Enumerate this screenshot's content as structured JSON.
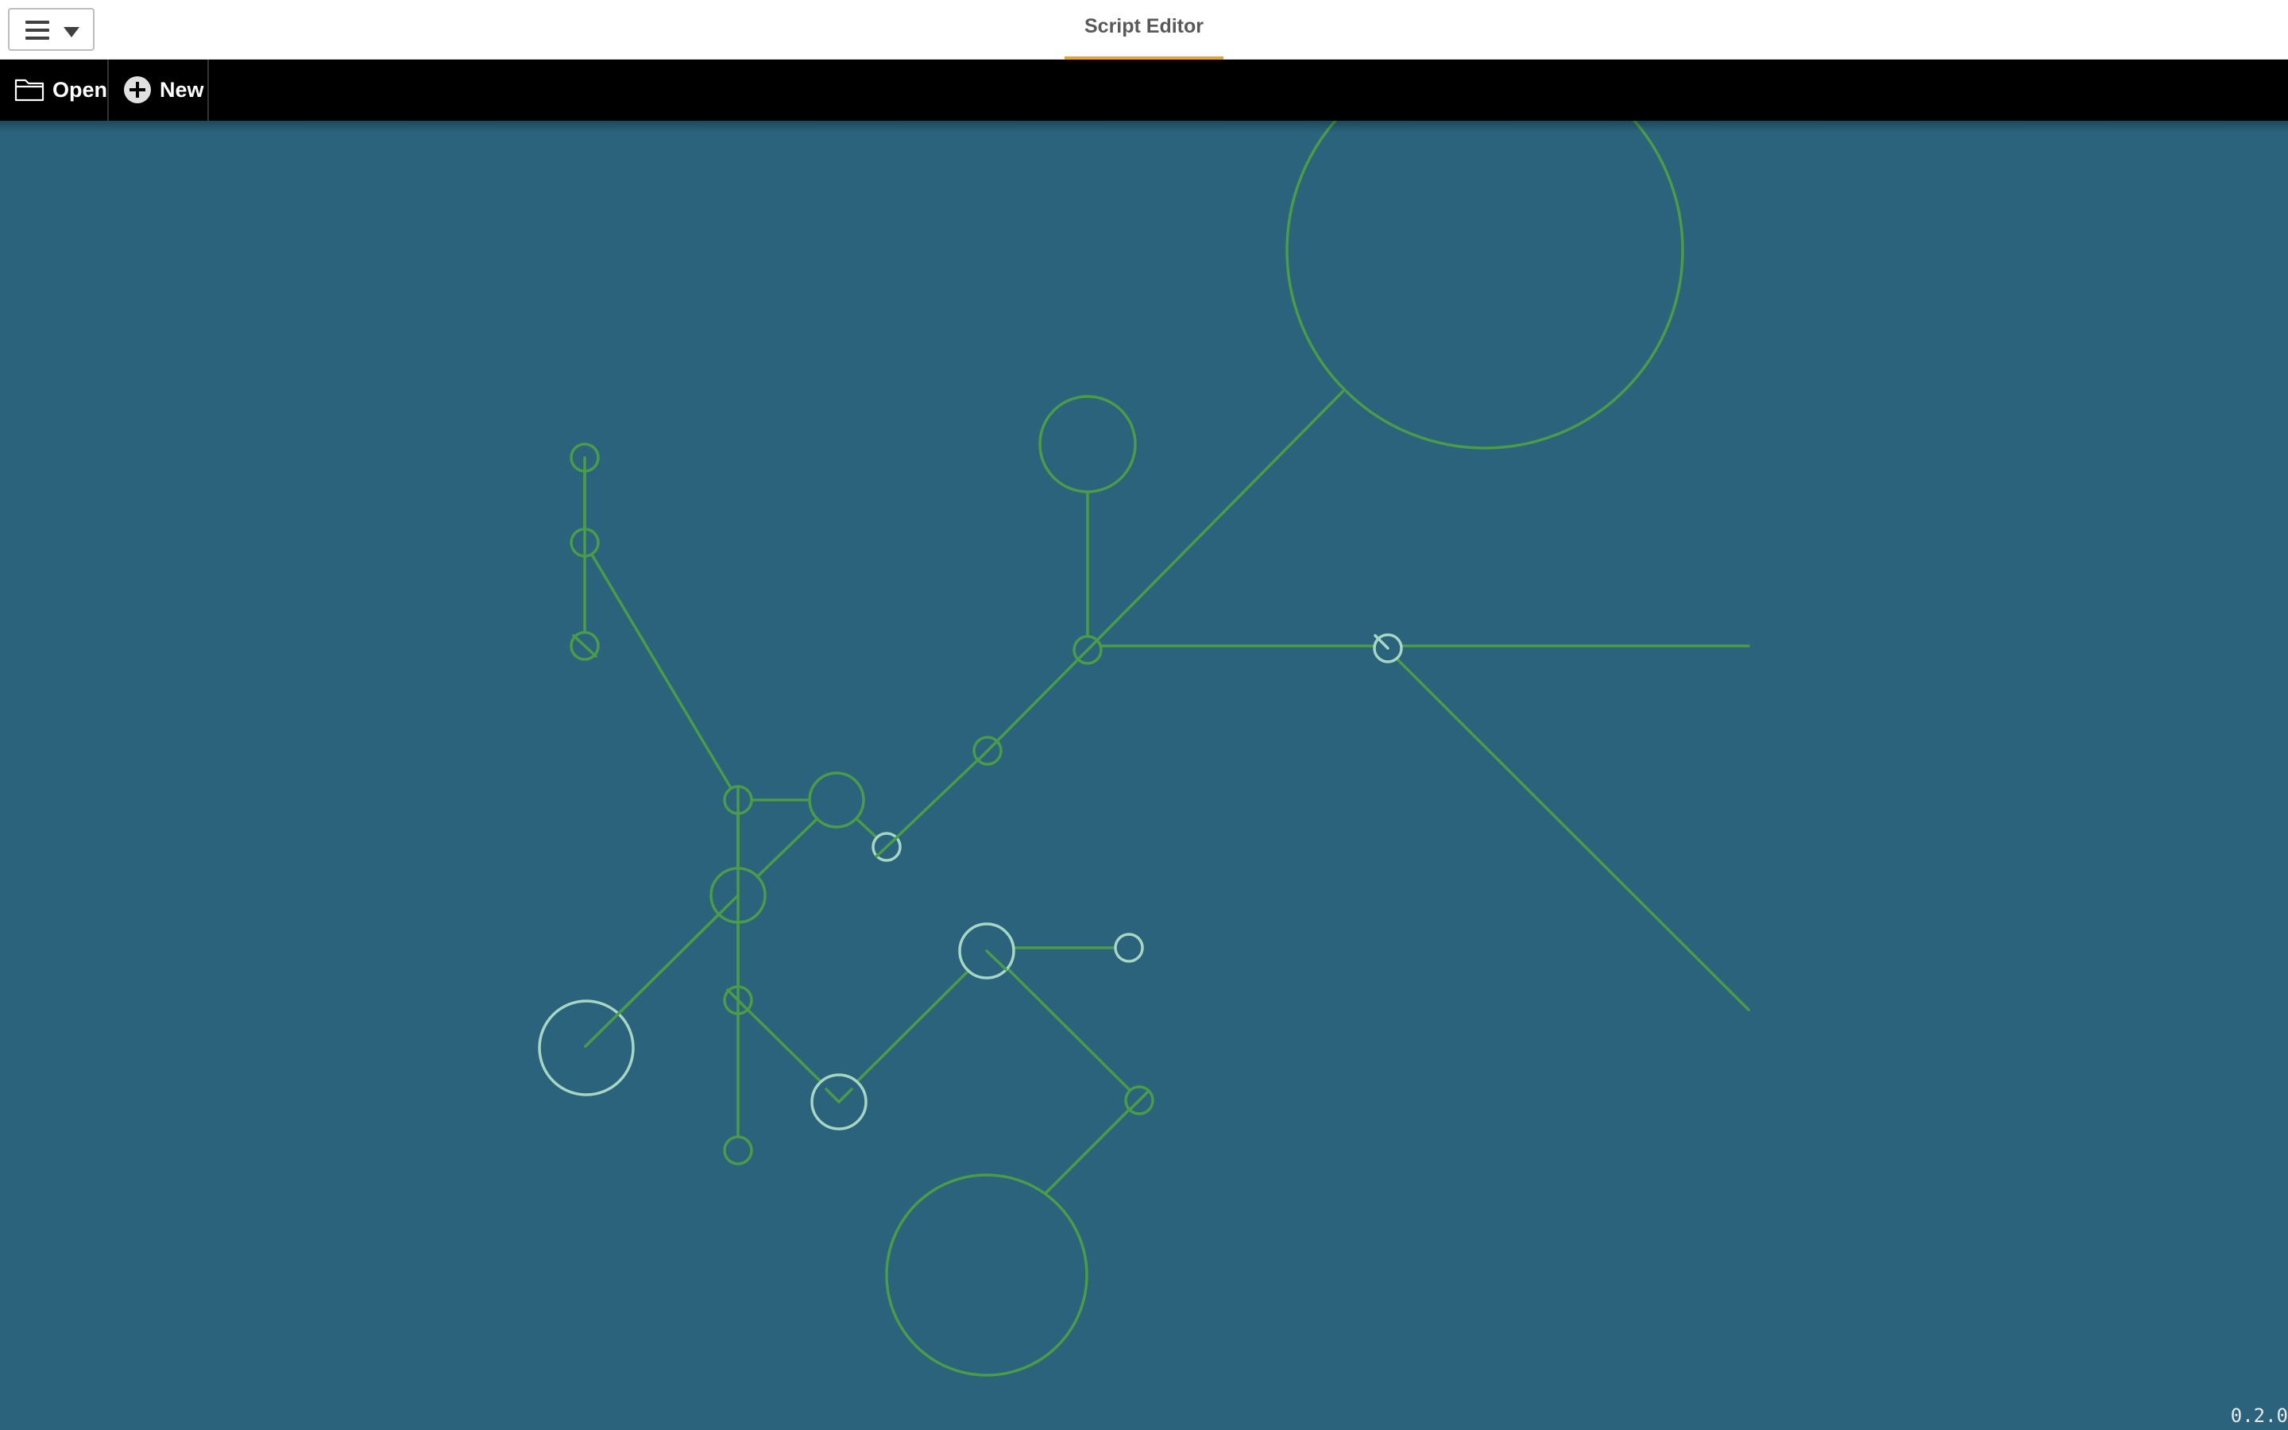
{
  "header": {
    "menu": {
      "icon": "hamburger-icon",
      "dropdown_icon": "chevron-down-icon"
    },
    "tabs": [
      {
        "label": "Script Editor",
        "active": true
      }
    ],
    "accent_color": "#e3a23a"
  },
  "toolbar": {
    "open": {
      "label": "Open",
      "icon": "folder-icon"
    },
    "new": {
      "label": "New",
      "icon": "add-circle-icon"
    }
  },
  "canvas": {
    "background_color": "#2a637b",
    "node_color_dark": "#4a9b4a",
    "node_color_light": "#a6d6c4",
    "line_color": "#4a9b4a"
  },
  "footer": {
    "version": "0.2.0"
  }
}
